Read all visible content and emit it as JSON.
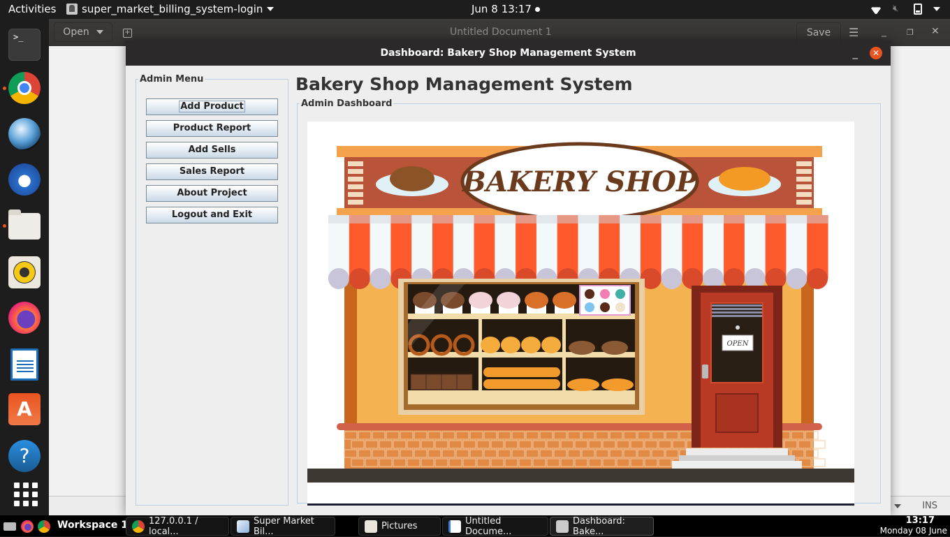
{
  "topbar": {
    "activities": "Activities",
    "app_name": "super_market_billing_system-login",
    "date": "Jun 8",
    "time": "13:17",
    "tray_icons": [
      "wifi-icon",
      "volume-muted-icon",
      "battery-charging-icon",
      "system-menu-caret"
    ]
  },
  "dock": {
    "items": [
      {
        "name": "terminal",
        "icon": "terminal-icon",
        "running": false
      },
      {
        "name": "chrome",
        "icon": "chrome-icon",
        "running": true
      },
      {
        "name": "openshot",
        "icon": "openshot-icon",
        "running": false
      },
      {
        "name": "thunderbird",
        "icon": "thunderbird-icon",
        "running": false
      },
      {
        "name": "files",
        "icon": "files-icon",
        "running": true
      },
      {
        "name": "rhythmbox",
        "icon": "rhythmbox-icon",
        "running": false
      },
      {
        "name": "firefox",
        "icon": "firefox-icon",
        "running": false
      },
      {
        "name": "libreoffice-writer",
        "icon": "writer-icon",
        "running": false
      },
      {
        "name": "ubuntu-software",
        "icon": "software-icon",
        "running": false
      },
      {
        "name": "help",
        "icon": "help-icon",
        "running": false
      },
      {
        "name": "show-applications",
        "icon": "grid-icon",
        "running": false
      }
    ],
    "terminal_glyph": ">_",
    "software_glyph": "A",
    "help_glyph": "?"
  },
  "gedit": {
    "open_label": "Open",
    "new_tab_glyph": "+",
    "title": "Untitled Document 1",
    "save_label": "Save",
    "menu_glyph": "☰",
    "minimize_glyph": "_",
    "maximize_glyph": "❐",
    "close_glyph": "✕",
    "status_mode": "INS"
  },
  "dashboard": {
    "window_title": "Dashboard: Bakery Shop Management System",
    "minimize_glyph": "_",
    "close_glyph": "✕",
    "heading": "Bakery Shop Management System",
    "admin_menu": {
      "legend": "Admin Menu",
      "buttons": [
        {
          "label": "Add Product",
          "focused": true
        },
        {
          "label": "Product Report"
        },
        {
          "label": "Add Sells"
        },
        {
          "label": "Sales Report"
        },
        {
          "label": "About Project"
        },
        {
          "label": "Logout and Exit"
        }
      ]
    },
    "admin_dashboard": {
      "legend": "Admin Dashboard",
      "banner": {
        "sign_text": "BAKERY SHOP",
        "door_sign": "OPEN",
        "colors": {
          "awning_red": "#ff5a2c",
          "awning_white": "#f3f8fb",
          "wall": "#f4b350",
          "sign_band": "#b9543b",
          "roof_trim": "#f5a24c",
          "door": "#b83a25",
          "window_dark": "#241a10",
          "ground": "#3e3832",
          "brick": "#e08a45"
        }
      }
    }
  },
  "taskbar": {
    "workspace": "Workspace 1",
    "tasks": [
      {
        "label": "127.0.0.1 / local...",
        "icon": "chrome-icon"
      },
      {
        "label": "Super Market Bil...",
        "icon": "cube-icon"
      },
      {
        "label": "Pictures",
        "icon": "folder-icon"
      },
      {
        "label": "Untitled Docume...",
        "icon": "text-editor-icon"
      },
      {
        "label": "Dashboard: Bake...",
        "icon": "java-icon",
        "active": true
      }
    ],
    "time": "13:17",
    "date": "Monday 08 June"
  }
}
